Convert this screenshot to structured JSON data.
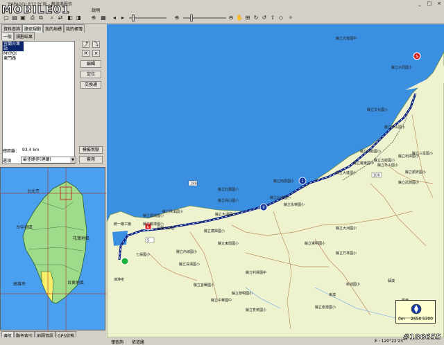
{
  "window": {
    "title": "PAPAGO! R12 PC版 - 蘇澳港圖資",
    "logo_text": "MOBILE01",
    "min_label": "_",
    "max_label": "□",
    "close_label": "×"
  },
  "menu": {
    "items": [
      "說明",
      "說明(D)"
    ]
  },
  "left_panel": {
    "tabs_row1": [
      "資料查詢",
      "路徑規劃",
      "我的地標",
      "我的帳簿"
    ],
    "tabs_row2": [
      "一般",
      "規劃結果"
    ],
    "route_list": [
      {
        "label": "宜蘭火車站",
        "selected": true
      },
      {
        "label": "MYPOI"
      },
      {
        "label": "東門路"
      }
    ],
    "buttons": {
      "edit": "編輯",
      "locate": "定位",
      "swap": "交換通",
      "simulate": "模擬駕駛",
      "apply": "套用"
    },
    "distance_label": "總距離：",
    "distance_value": "93.4 km",
    "option_label": "選項",
    "option_value": "最佳路徑(建議)"
  },
  "overview_map": {
    "labels": [
      "台北市",
      "台中地區",
      "花蓮地區",
      "高雄市",
      "台東地區"
    ]
  },
  "bottom_tabs": [
    "導航",
    "縣市索引",
    "地圖資訊",
    "GPS狀態"
  ],
  "map": {
    "labels": [
      "縣立光復國中",
      "縣立大同國小",
      "縣立文化國小",
      "縣立中山國小",
      "縣立五結國小",
      "縣立利澤國小",
      "縣立四結國小",
      "縣立羅東國中",
      "縣立三星國小",
      "縣立冬山國小",
      "縣立順安國小",
      "縣立武淵國小",
      "縣立大進國小",
      "縣立南屏國小",
      "縣立北成國小",
      "縣立廣興國小",
      "縣立東興國小",
      "縣立永樂國小",
      "縣立大洲國小",
      "縣立憲明國小",
      "縣立竹林國小",
      "縣立利澤國中",
      "東澳",
      "蘇澳",
      "羅東",
      "新城國小",
      "縣立壯圍國小",
      "縣立礁溪國小",
      "縣立龍潭國小",
      "縣立頭城國小",
      "縣立員山國小",
      "縣立大湖國小",
      "縣立內城國小",
      "縣立深溝國小",
      "縣立宜蘭國小",
      "縣立中華國中",
      "縣立黎明國小",
      "縣立育英國小",
      "七張國小",
      "凍港坐",
      "宜蘭火車站",
      "統一廠工廠",
      "縣立南澳國小"
    ],
    "route_markers": [
      "S",
      "E",
      "9",
      "1"
    ],
    "road_numbers": [
      "5",
      "106",
      "199",
      "9",
      "2"
    ]
  },
  "compass": {
    "label": "0m",
    "scale_a": "2650",
    "scale_b": "5300"
  },
  "status": {
    "left": "僅查詢",
    "mid": "依道路",
    "coords": "E : 120°22'23\"",
    "watermark": "#186655"
  },
  "colors": {
    "sea": "#3b8fe0",
    "land": "#eef2cf",
    "route": "#0a2080",
    "accent": "#e02020",
    "chrome": "#d4d0c8"
  }
}
